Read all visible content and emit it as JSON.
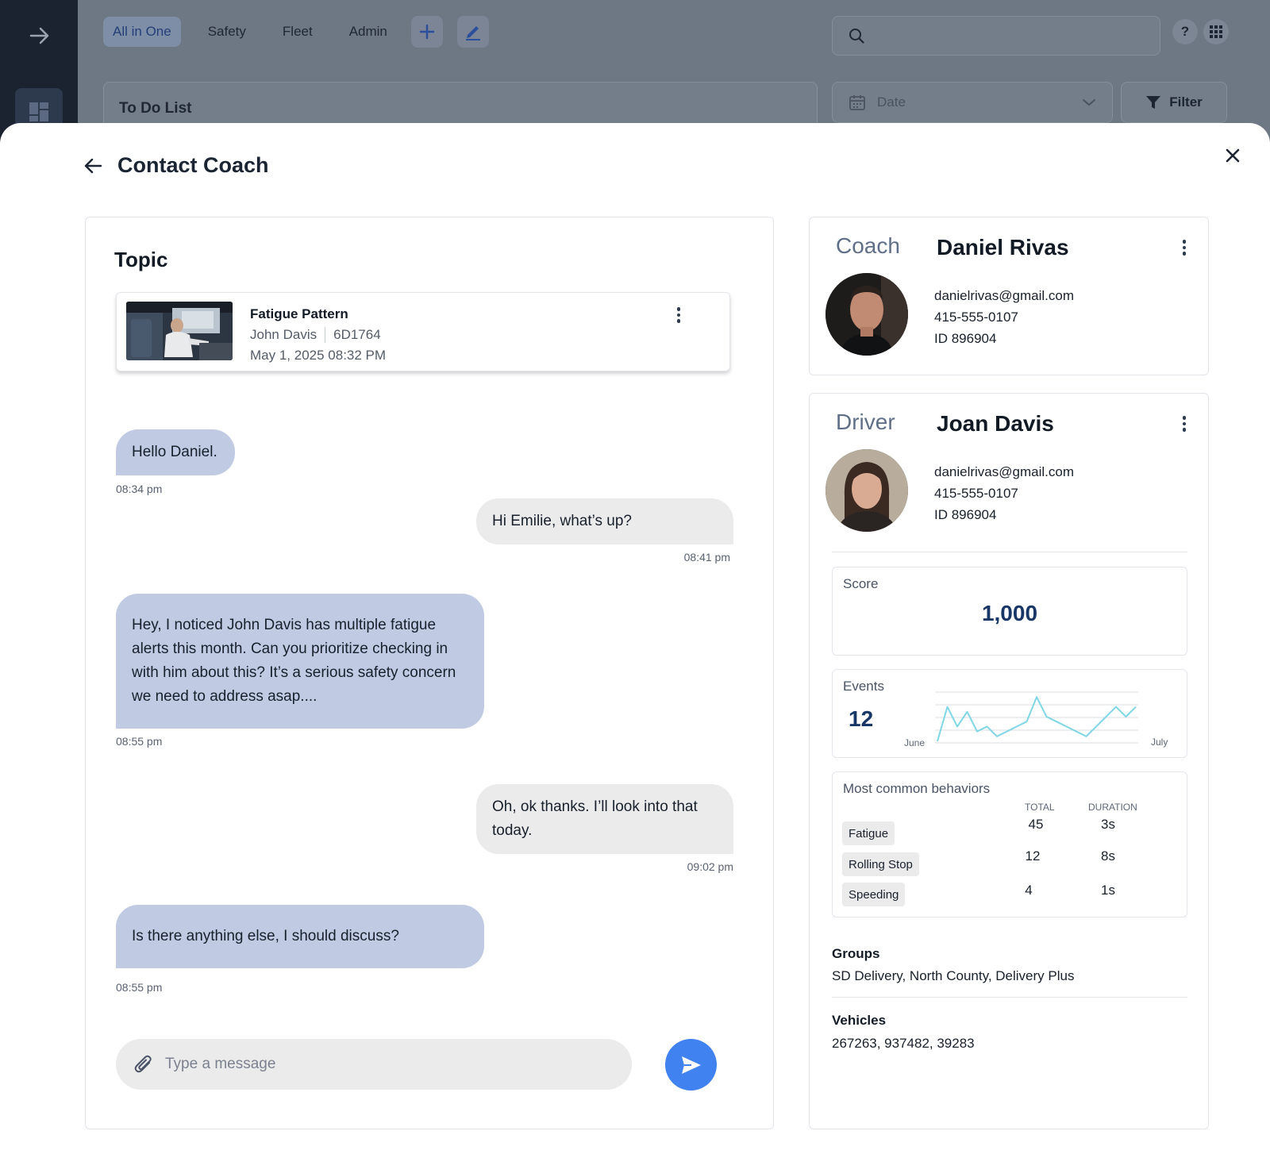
{
  "topbar": {
    "tabs": [
      "All in One",
      "Safety",
      "Fleet",
      "Admin"
    ],
    "active_tab": "All in One",
    "help_label": "?"
  },
  "todo": {
    "title": "To Do List"
  },
  "date_filter": {
    "placeholder": "Date"
  },
  "filter_button": {
    "label": "Filter"
  },
  "modal": {
    "title": "Contact Coach"
  },
  "topic": {
    "heading": "Topic",
    "event_name": "Fatigue Pattern",
    "driver": "John Davis",
    "vehicle": "6D1764",
    "datetime": "May 1, 2025 08:32 PM"
  },
  "messages": [
    {
      "direction": "in",
      "text": "Hello Daniel.",
      "time": "08:34 pm"
    },
    {
      "direction": "out",
      "text": "Hi Emilie, what’s up?",
      "time": "08:41 pm"
    },
    {
      "direction": "in",
      "text": "Hey, I noticed John Davis has multiple fatigue alerts this month. Can you prioritize checking in with him about this? It’s a serious safety concern we need to address asap....",
      "time": "08:55 pm"
    },
    {
      "direction": "out",
      "text": "Oh, ok thanks. I’ll look into that today.",
      "time": "09:02 pm"
    },
    {
      "direction": "in",
      "text": "Is there anything else, I should discuss?",
      "time": "08:55 pm"
    }
  ],
  "composer": {
    "placeholder": "Type a message"
  },
  "coach": {
    "role": "Coach",
    "name": "Daniel Rivas",
    "email": "danielrivas@gmail.com",
    "phone": "415-555-0107",
    "id": "ID 896904"
  },
  "driver": {
    "role": "Driver",
    "name": "Joan Davis",
    "email": "danielrivas@gmail.com",
    "phone": "415-555-0107",
    "id": "ID 896904"
  },
  "score": {
    "label": "Score",
    "value": "1,000"
  },
  "events": {
    "label": "Events",
    "value": "12",
    "chart_data": {
      "type": "line",
      "x_start_label": "June",
      "x_end_label": "July",
      "values": [
        0,
        7,
        3,
        6,
        2,
        3,
        1,
        2,
        3,
        4,
        9,
        5,
        4,
        3,
        2,
        1,
        3,
        5,
        7,
        5,
        7
      ],
      "ylim": [
        0,
        10
      ],
      "line_color": "#7fd6e4",
      "grid": true
    }
  },
  "behaviors": {
    "label": "Most common behaviors",
    "columns": [
      "TOTAL",
      "DURATION"
    ],
    "rows": [
      {
        "name": "Fatigue",
        "total": "45",
        "duration": "3s"
      },
      {
        "name": "Rolling Stop",
        "total": "12",
        "duration": "8s"
      },
      {
        "name": "Speeding",
        "total": "4",
        "duration": "1s"
      }
    ]
  },
  "groups": {
    "label": "Groups",
    "value": "SD Delivery, North County, Delivery Plus"
  },
  "vehicles": {
    "label": "Vehicles",
    "value": "267263, 937482, 39283"
  },
  "colors": {
    "accent": "#4082f0",
    "incoming_bubble": "#c0cbe3",
    "outgoing_bubble": "#ebebeb",
    "metric_text": "#183766"
  },
  "icons": [
    "arrow-right-icon",
    "dashboard-icon",
    "plus-icon",
    "pencil-icon",
    "search-icon",
    "help-icon",
    "grid-icon",
    "calendar-icon",
    "chevron-down-icon",
    "filter-icon",
    "back-arrow-icon",
    "close-icon",
    "kebab-icon",
    "paperclip-icon",
    "send-icon"
  ]
}
